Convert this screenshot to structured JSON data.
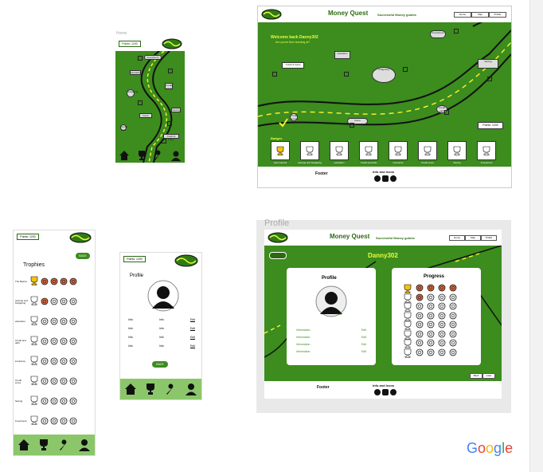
{
  "brand": {
    "name": "Money Quest",
    "tagline": "Successful Money guides"
  },
  "points_label": "Points: 1200",
  "points_label_small": "Points: 1200",
  "welcome": {
    "line1": "Welcome back Danny302",
    "line2": "Are you/re then learning at?"
  },
  "desktop_nav": [
    "Home",
    "Map",
    "Profile"
  ],
  "signs": [
    "Investment",
    "education",
    "Credit scores",
    "budgeting",
    "Saving",
    "home",
    "Credit card",
    "Credit & loans"
  ],
  "badges_title": "Badges",
  "badge_labels": [
    "Fast Careful",
    "savings and budgeting",
    "education",
    "Credit and debt",
    "insurance",
    "Credit score",
    "Saving",
    "investment"
  ],
  "footer": {
    "title": "Footer",
    "info": "Info and Icons"
  },
  "trophies": {
    "title": "Trophies",
    "back": "BACK",
    "rows": [
      "The Basics",
      "savings and budgeting",
      "education",
      "Credit and debt",
      "insurance",
      "Credit score",
      "Saving",
      "investment"
    ]
  },
  "profile_mobile": {
    "title": "Profile",
    "avatar_caption": "Edit",
    "back": "BACK",
    "rows": [
      [
        "Info",
        "Info",
        "Edit"
      ],
      [
        "Info",
        "Info",
        "Edit"
      ],
      [
        "Info",
        "Info",
        "Edit"
      ],
      [
        "Info",
        "Info",
        "Edit"
      ]
    ]
  },
  "profile_desktop": {
    "tab_label": "Profile",
    "username": "Danny302",
    "profile_title": "Profile",
    "progress_title": "Progress",
    "avatar_caption": "Edit",
    "info_rows": [
      [
        "Information",
        "Edit"
      ],
      [
        "Information",
        "Edit"
      ],
      [
        "Information",
        "Edit"
      ],
      [
        "Information",
        "Edit"
      ]
    ],
    "buttons": [
      "Back",
      "Later"
    ]
  },
  "mobile_map_label": "Home",
  "google": {
    "G": "G",
    "o1": "o",
    "o2": "o",
    "g": "g",
    "l": "l",
    "e": "e"
  },
  "colors": {
    "green": "#3c8c1e",
    "yellow": "#f3f02c",
    "white": "#ffffff",
    "dark": "#111111",
    "blue": "#4285F4",
    "red": "#EA4335",
    "gold": "#FBBC05",
    "lgreen": "#34A853"
  }
}
